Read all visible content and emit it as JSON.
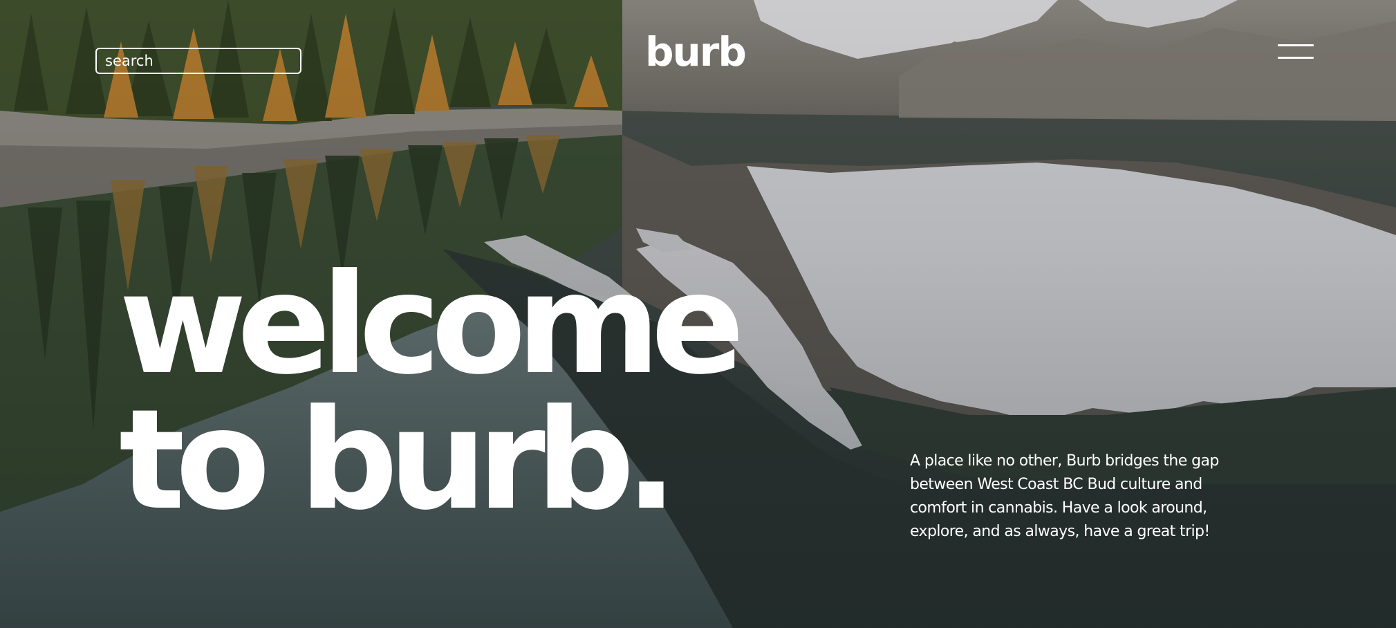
{
  "header": {
    "search_placeholder": "search",
    "logo": "burb",
    "menu_icon": "hamburger-menu-icon"
  },
  "hero": {
    "headline_line1": "welcome",
    "headline_line2": "to burb.",
    "intro": "A place like no other, Burb bridges the gap between West Coast BC Bud culture and comfort in cannabis. Have a look around, explore, and as always, have a great trip!"
  },
  "colors": {
    "text": "#ffffff",
    "water": "#3a4a48",
    "forest": "#3f4f2c",
    "larch": "#b07a2e",
    "snow": "#d9d9dc",
    "rock": "#77736d"
  }
}
